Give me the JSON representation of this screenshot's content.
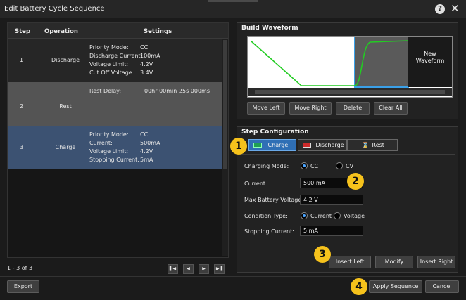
{
  "window": {
    "title": "Edit Battery Cycle Sequence"
  },
  "table": {
    "headers": {
      "step": "Step",
      "operation": "Operation",
      "settings": "Settings"
    },
    "rows": [
      {
        "step": "1",
        "operation": "Discharge",
        "settings": [
          {
            "k": "Priority Mode:",
            "v": "CC"
          },
          {
            "k": "Discharge Current:",
            "v": "100mA"
          },
          {
            "k": "Voltage Limit:",
            "v": "4.2V"
          },
          {
            "k": "Cut Off Voltage:",
            "v": "3.4V"
          }
        ]
      },
      {
        "step": "2",
        "operation": "Rest",
        "settings": [
          {
            "k": "Rest Delay:",
            "v": "00hr 00min 25s 000ms"
          }
        ]
      },
      {
        "step": "3",
        "operation": "Charge",
        "settings": [
          {
            "k": "Priority Mode:",
            "v": "CC"
          },
          {
            "k": "Current:",
            "v": "500mA"
          },
          {
            "k": "Voltage Limit:",
            "v": "4.2V"
          },
          {
            "k": "Stopping Current:",
            "v": "5mA"
          }
        ]
      }
    ]
  },
  "pager": {
    "text": "1 - 3 of 3",
    "icons": [
      "first-page-icon",
      "prev-page-icon",
      "next-page-icon",
      "last-page-icon"
    ]
  },
  "build": {
    "title": "Build Waveform",
    "new_waveform": "New\nWaveform",
    "buttons": {
      "move_left": "Move Left",
      "move_right": "Move Right",
      "delete": "Delete",
      "clear_all": "Clear All"
    },
    "colors": {
      "trace": "#22cc22",
      "selection": "#3aa0e8"
    }
  },
  "stepcfg": {
    "title": "Step Configuration",
    "tabs": {
      "charge": "Charge",
      "discharge": "Discharge",
      "rest": "Rest"
    },
    "charging_mode": {
      "label": "Charging Mode:",
      "opt1": "CC",
      "opt2": "CV",
      "selected": "CC"
    },
    "current": {
      "label": "Current:",
      "value": "500 mA"
    },
    "max_voltage": {
      "label": "Max Battery Voltage:",
      "value": "4.2 V"
    },
    "condition": {
      "label": "Condition Type:",
      "opt1": "Current",
      "opt2": "Voltage",
      "selected": "Current"
    },
    "stopping_current": {
      "label": "Stopping Current:",
      "value": "5 mA"
    },
    "buttons": {
      "insert_left": "Insert Left",
      "modify": "Modify",
      "insert_right": "Insert Right"
    }
  },
  "footer": {
    "export": "Export",
    "apply": "Apply Sequence",
    "cancel": "Cancel"
  },
  "callouts": [
    "1",
    "2",
    "3",
    "4"
  ],
  "accent": "#2f6fb5",
  "callout_color": "#f6c21c"
}
